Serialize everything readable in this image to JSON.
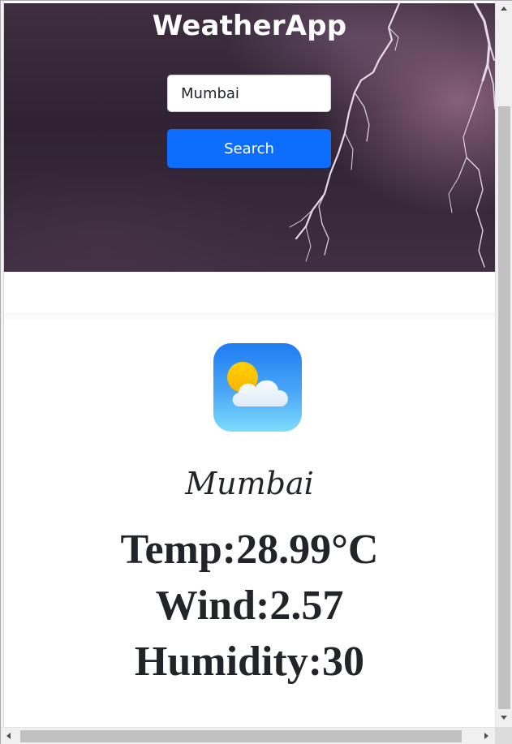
{
  "app": {
    "title": "WeatherApp"
  },
  "search": {
    "value": "Mumbai",
    "button_label": "Search"
  },
  "result": {
    "icon": "partly-cloudy-icon",
    "city": "Mumbai",
    "temp_text": "Temp:28.99°C",
    "wind_text": "Wind:2.57",
    "humidity_text": "Humidity:30"
  },
  "colors": {
    "primary_button": "#0d6efd",
    "text": "#212529",
    "hero_overlay": "#2a1f2e"
  }
}
